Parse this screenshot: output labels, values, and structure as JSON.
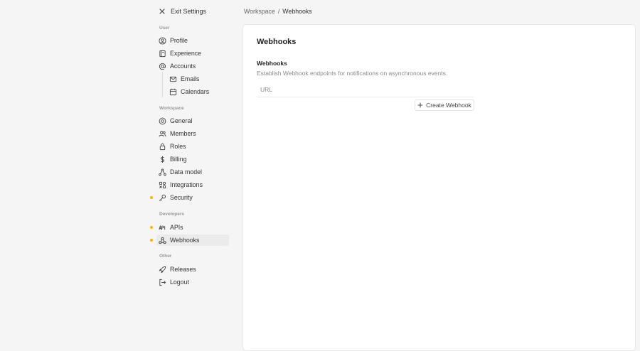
{
  "sidebar": {
    "exit_label": "Exit Settings",
    "sections": {
      "user": "User",
      "workspace": "Workspace",
      "developers": "Developers",
      "other": "Other"
    },
    "items": {
      "profile": "Profile",
      "experience": "Experience",
      "accounts": "Accounts",
      "emails": "Emails",
      "calendars": "Calendars",
      "general": "General",
      "members": "Members",
      "roles": "Roles",
      "billing": "Billing",
      "data_model": "Data model",
      "integrations": "Integrations",
      "security": "Security",
      "apis": "APIs",
      "webhooks": "Webhooks",
      "releases": "Releases",
      "logout": "Logout"
    },
    "active_item": "webhooks",
    "dot_color": "#ffb300"
  },
  "breadcrumb": {
    "parent": "Workspace",
    "separator": "/",
    "current": "Webhooks"
  },
  "main": {
    "title": "Webhooks",
    "section_heading": "Webhooks",
    "section_description": "Establish Webhook endpoints for notifications on asynchronous events.",
    "table": {
      "columns": [
        "URL"
      ]
    },
    "create_button": "Create Webhook"
  }
}
